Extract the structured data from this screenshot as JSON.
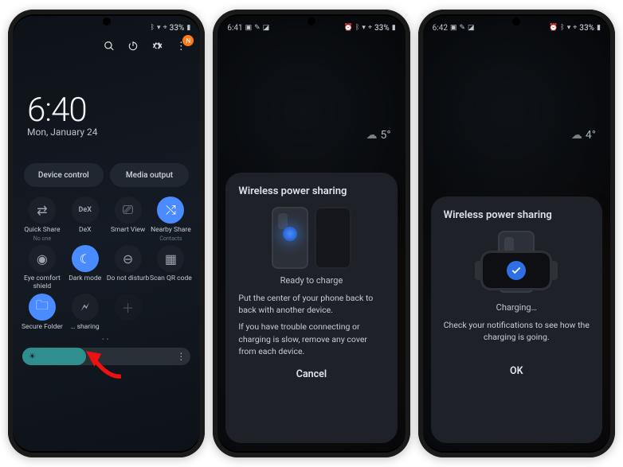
{
  "phone1": {
    "status": {
      "time": "",
      "icons": [
        "bluetooth",
        "wifi",
        "location",
        "vibrate"
      ],
      "battery": "33%"
    },
    "header_icons": [
      "search",
      "power",
      "settings",
      "notif-badge"
    ],
    "clock": {
      "time": "6:40",
      "date": "Mon, January 24"
    },
    "chips": [
      "Device control",
      "Media output"
    ],
    "tiles": [
      {
        "label": "Quick Share",
        "sub": "No one",
        "on": false,
        "icon": "share"
      },
      {
        "label": "DeX",
        "sub": "",
        "on": false,
        "icon": "dex"
      },
      {
        "label": "Smart View",
        "sub": "",
        "on": false,
        "icon": "cast"
      },
      {
        "label": "Nearby Share",
        "sub": "Contacts",
        "on": true,
        "icon": "nearby"
      },
      {
        "label": "Eye comfort shield",
        "sub": "",
        "on": false,
        "icon": "eye"
      },
      {
        "label": "Dark mode",
        "sub": "",
        "on": true,
        "icon": "moon"
      },
      {
        "label": "Do not disturb",
        "sub": "",
        "on": false,
        "icon": "dnd"
      },
      {
        "label": "Scan QR code",
        "sub": "",
        "on": false,
        "icon": "qr"
      },
      {
        "label": "Secure Folder",
        "sub": "",
        "on": true,
        "icon": "folder"
      },
      {
        "label": "… sharing",
        "sub": "",
        "on": false,
        "icon": "battery-share"
      },
      {
        "label": "",
        "sub": "",
        "on": false,
        "icon": "plus"
      }
    ],
    "brightness_pct": 38
  },
  "phone2": {
    "status": {
      "time": "6:41",
      "icons": [
        "img",
        "check",
        "sim",
        "bluetooth",
        "wifi",
        "vibrate",
        "location"
      ],
      "battery": "33%"
    },
    "weather": {
      "icon": "cloud",
      "temp": "5°"
    },
    "sheet": {
      "title": "Wireless power sharing",
      "status": "Ready to charge",
      "body1": "Put the center of your phone back to back with another device.",
      "body2": "If you have trouble connecting or charging is slow, remove any cover from each device.",
      "button": "Cancel"
    }
  },
  "phone3": {
    "status": {
      "time": "6:42",
      "icons": [
        "img",
        "check",
        "sim",
        "bluetooth",
        "wifi",
        "vibrate",
        "location"
      ],
      "battery": "33%"
    },
    "weather": {
      "icon": "cloud",
      "temp": "4°"
    },
    "sheet": {
      "title": "Wireless power sharing",
      "status": "Charging…",
      "body": "Check your notifications to see how the charging is going.",
      "button": "OK"
    }
  }
}
